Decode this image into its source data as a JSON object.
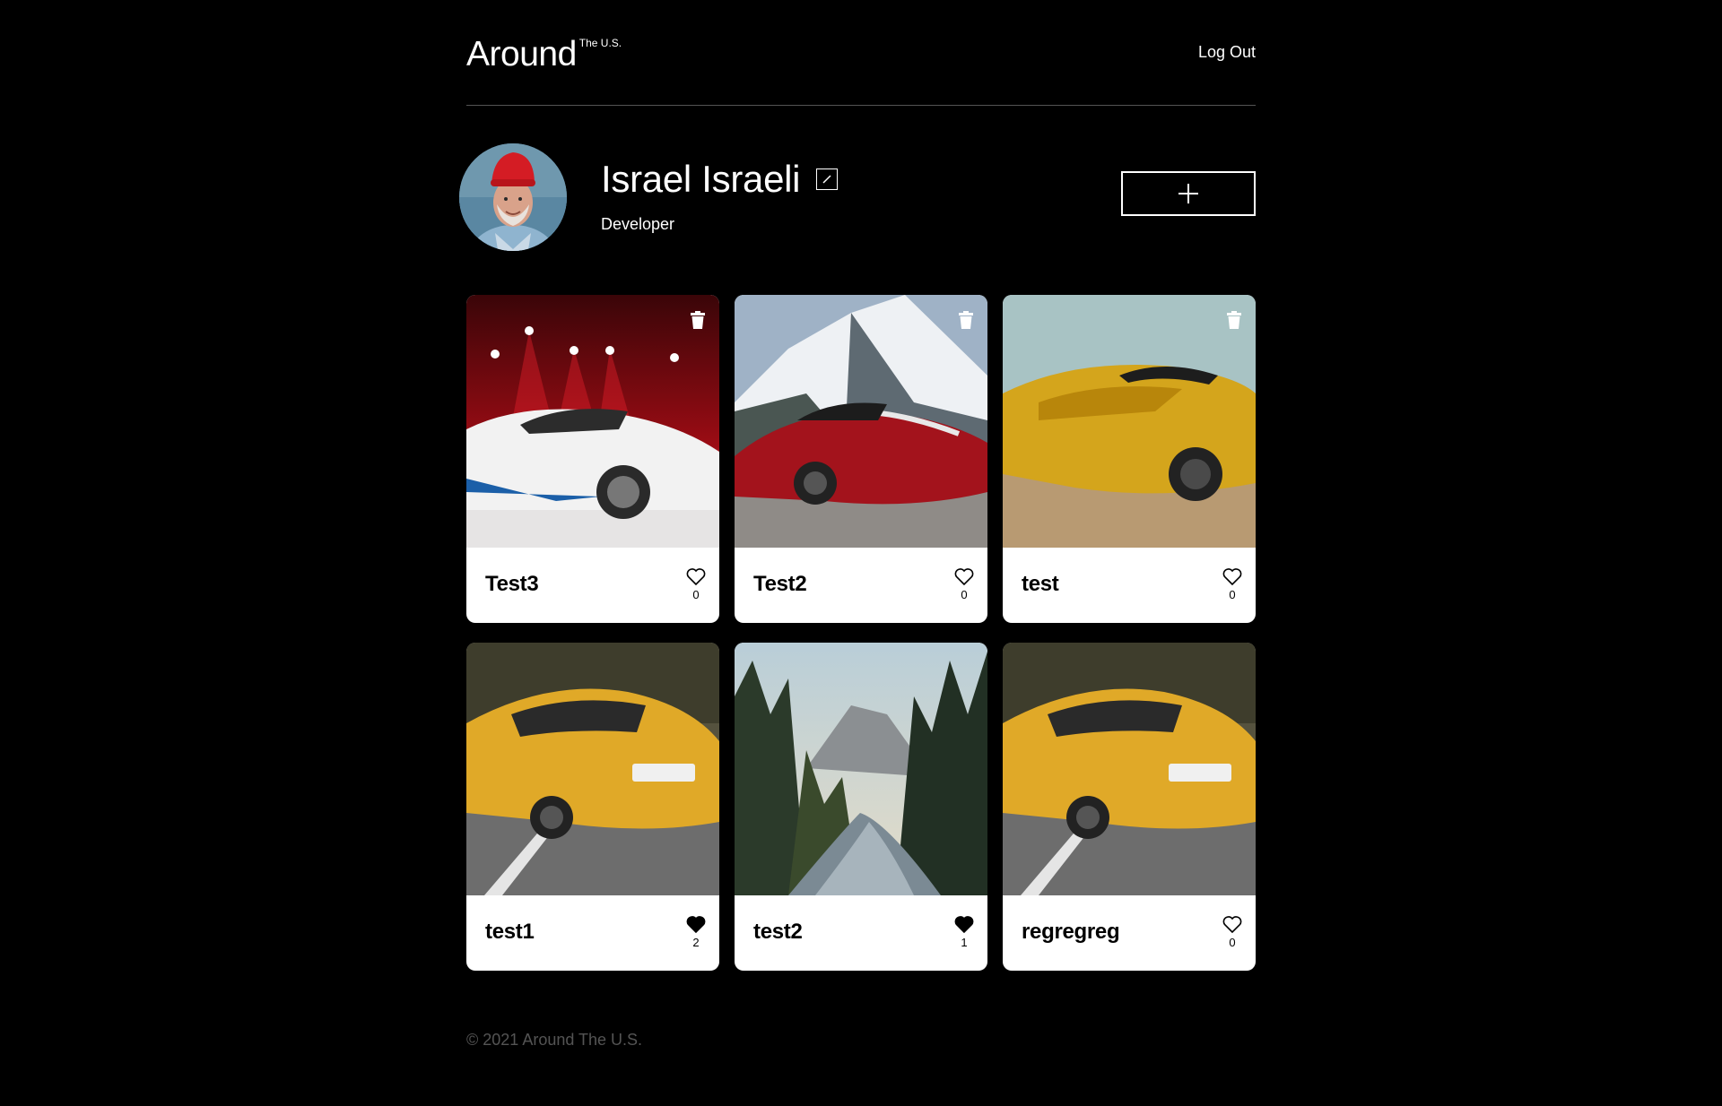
{
  "header": {
    "logo": "Around",
    "logo_sup": "The U.S.",
    "logout": "Log Out"
  },
  "profile": {
    "name": "Israel Israeli",
    "job": "Developer"
  },
  "cards": [
    {
      "title": "Test3",
      "likes": "0",
      "liked": false,
      "deletable": true
    },
    {
      "title": "Test2",
      "likes": "0",
      "liked": false,
      "deletable": true
    },
    {
      "title": "test",
      "likes": "0",
      "liked": false,
      "deletable": true
    },
    {
      "title": "test1",
      "likes": "2",
      "liked": true,
      "deletable": false
    },
    {
      "title": "test2",
      "likes": "1",
      "liked": true,
      "deletable": false
    },
    {
      "title": "regregreg",
      "likes": "0",
      "liked": false,
      "deletable": false
    }
  ],
  "footer": {
    "copyright": "© 2021 Around The U.S."
  },
  "colors": {
    "background": "#000000",
    "card": "#ffffff",
    "footer_text": "#545454"
  }
}
